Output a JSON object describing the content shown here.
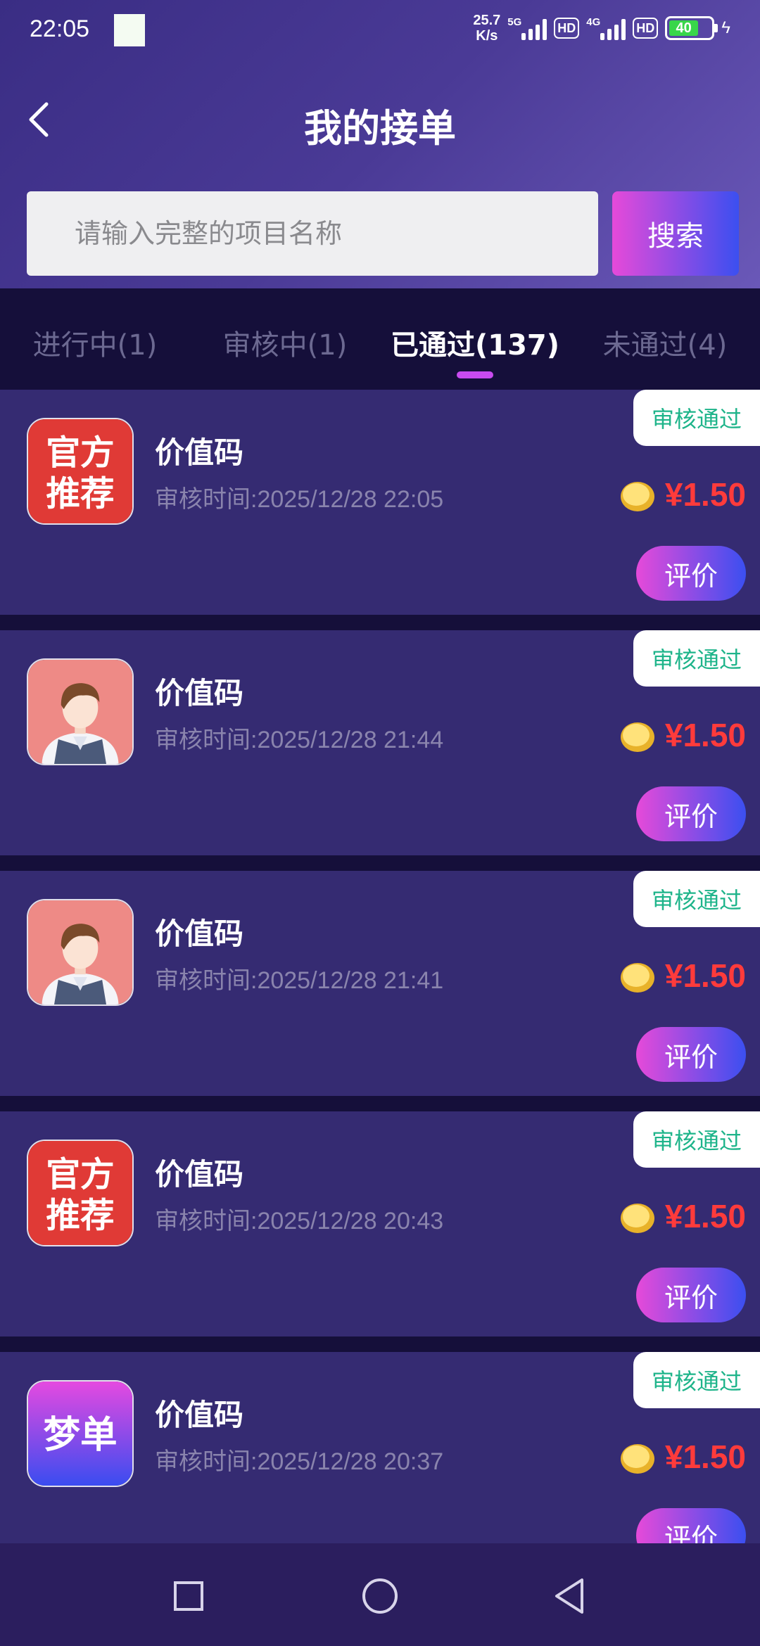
{
  "status_bar": {
    "time": "22:05",
    "net_speed_value": "25.7",
    "net_speed_unit": "K/s",
    "sim1_label": "5G",
    "sim1_hd": "HD",
    "sim2_label": "4G",
    "sim2_hd": "HD",
    "battery": "40"
  },
  "nav": {
    "title": "我的接单"
  },
  "search": {
    "placeholder": "请输入完整的项目名称",
    "button_label": "搜索"
  },
  "tabs": [
    {
      "label": "进行中(1)",
      "active": false
    },
    {
      "label": "审核中(1)",
      "active": false
    },
    {
      "label": "已通过(137)",
      "active": true
    },
    {
      "label": "未通过(4)",
      "active": false
    }
  ],
  "orders": [
    {
      "icon": "official-recommend-icon",
      "icon_text_1": "官方",
      "icon_text_2": "推荐",
      "title": "价值码",
      "time": "审核时间:2025/12/28 22:05",
      "status": "审核通过",
      "price": "¥1.50",
      "action": "评价"
    },
    {
      "icon": "avatar-icon",
      "title": "价值码",
      "time": "审核时间:2025/12/28 21:44",
      "status": "审核通过",
      "price": "¥1.50",
      "action": "评价"
    },
    {
      "icon": "avatar-icon",
      "title": "价值码",
      "time": "审核时间:2025/12/28 21:41",
      "status": "审核通过",
      "price": "¥1.50",
      "action": "评价"
    },
    {
      "icon": "official-recommend-icon",
      "icon_text_1": "官方",
      "icon_text_2": "推荐",
      "title": "价值码",
      "time": "审核时间:2025/12/28 20:43",
      "status": "审核通过",
      "price": "¥1.50",
      "action": "评价"
    },
    {
      "icon": "mengdan-logo-icon",
      "icon_text_1": "梦单",
      "title": "价值码",
      "time": "审核时间:2025/12/28 20:37",
      "status": "审核通过",
      "price": "¥1.50",
      "action": "评价"
    }
  ],
  "colors": {
    "accent_pink": "#e64ad9",
    "accent_blue": "#3b4ff0",
    "price_red": "#ff3b3b",
    "status_green": "#1eb48a"
  }
}
